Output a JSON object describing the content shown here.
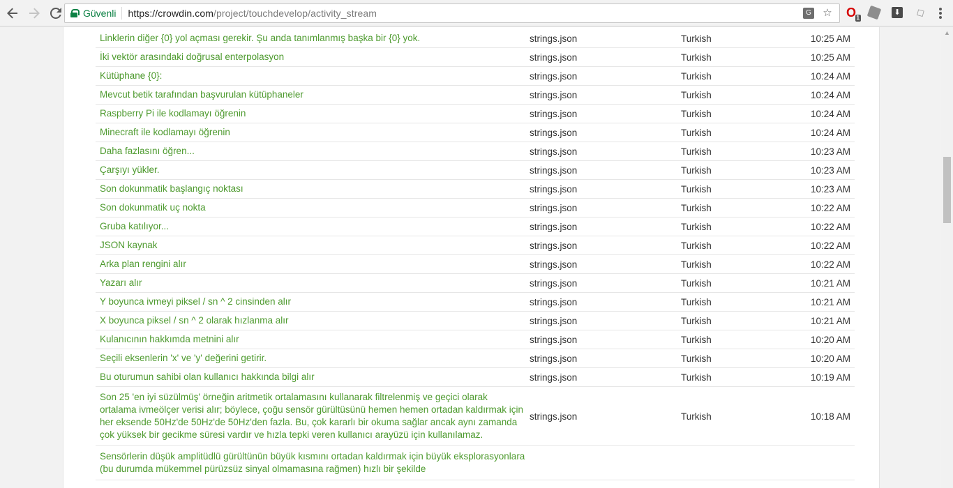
{
  "browser": {
    "secure_label": "Güvenli",
    "url_domain": "https://crowdin.com",
    "url_path": "/project/touchdevelop/activity_stream",
    "extension_badge": "1"
  },
  "activity": [
    {
      "text": "Linklerin diğer {0} yol açması gerekir. Şu anda tanımlanmış başka bir {0} yok.",
      "file": "strings.json",
      "language": "Turkish",
      "time": "10:25 AM"
    },
    {
      "text": "İki vektör arasındaki doğrusal enterpolasyon",
      "file": "strings.json",
      "language": "Turkish",
      "time": "10:25 AM"
    },
    {
      "text": "Kütüphane {0}:",
      "file": "strings.json",
      "language": "Turkish",
      "time": "10:24 AM"
    },
    {
      "text": "Mevcut betik tarafından başvurulan kütüphaneler",
      "file": "strings.json",
      "language": "Turkish",
      "time": "10:24 AM"
    },
    {
      "text": "Raspberry Pi ile kodlamayı öğrenin",
      "file": "strings.json",
      "language": "Turkish",
      "time": "10:24 AM"
    },
    {
      "text": "Minecraft ile kodlamayı öğrenin",
      "file": "strings.json",
      "language": "Turkish",
      "time": "10:24 AM"
    },
    {
      "text": "Daha fazlasını öğren...",
      "file": "strings.json",
      "language": "Turkish",
      "time": "10:23 AM"
    },
    {
      "text": "Çarşıyı yükler.",
      "file": "strings.json",
      "language": "Turkish",
      "time": "10:23 AM"
    },
    {
      "text": "Son dokunmatik başlangıç noktası",
      "file": "strings.json",
      "language": "Turkish",
      "time": "10:23 AM"
    },
    {
      "text": "Son dokunmatik uç nokta",
      "file": "strings.json",
      "language": "Turkish",
      "time": "10:22 AM"
    },
    {
      "text": "Gruba katılıyor...",
      "file": "strings.json",
      "language": "Turkish",
      "time": "10:22 AM"
    },
    {
      "text": "JSON kaynak",
      "file": "strings.json",
      "language": "Turkish",
      "time": "10:22 AM"
    },
    {
      "text": "Arka plan rengini alır",
      "file": "strings.json",
      "language": "Turkish",
      "time": "10:22 AM"
    },
    {
      "text": "Yazarı alır",
      "file": "strings.json",
      "language": "Turkish",
      "time": "10:21 AM"
    },
    {
      "text": "Y boyunca ivmeyi piksel / sn ^ 2 cinsinden alır",
      "file": "strings.json",
      "language": "Turkish",
      "time": "10:21 AM"
    },
    {
      "text": "X boyunca piksel / sn ^ 2 olarak hızlanma alır",
      "file": "strings.json",
      "language": "Turkish",
      "time": "10:21 AM"
    },
    {
      "text": "Kulanıcının hakkımda metnini alır",
      "file": "strings.json",
      "language": "Turkish",
      "time": "10:20 AM"
    },
    {
      "text": "Seçili eksenlerin 'x' ve 'y' değerini getirir.",
      "file": "strings.json",
      "language": "Turkish",
      "time": "10:20 AM"
    },
    {
      "text": "Bu oturumun sahibi olan kullanıcı hakkında bilgi alır",
      "file": "strings.json",
      "language": "Turkish",
      "time": "10:19 AM"
    },
    {
      "text": "Son 25 'en iyi süzülmüş' örneğin aritmetik ortalamasını kullanarak filtrelenmiş ve geçici olarak ortalama ivmeölçer verisi alır; böylece, çoğu sensör gürültüsünü hemen hemen ortadan kaldırmak için her eksende 50Hz'de 50Hz'de 50Hz'den fazla. Bu, çok kararlı bir okuma sağlar ancak aynı zamanda çok yüksek bir gecikme süresi vardır ve hızla tepki veren kullanıcı arayüzü için kullanılamaz.",
      "file": "strings.json",
      "language": "Turkish",
      "time": "10:18 AM"
    },
    {
      "text": "Sensörlerin düşük amplitüdlü gürültünün büyük kısmını ortadan kaldırmak için büyük eksplorasyonlara (bu durumda mükemmel pürüzsüz sinyal olmamasına rağmen) hızlı bir şekilde",
      "file": "",
      "language": "",
      "time": ""
    }
  ]
}
